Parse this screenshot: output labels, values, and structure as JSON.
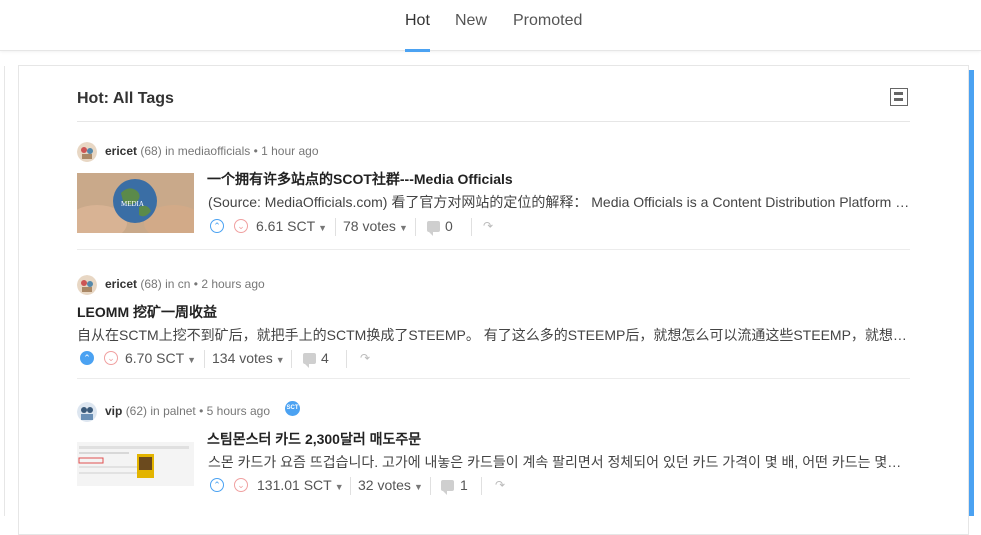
{
  "nav": {
    "tabs": [
      {
        "label": "Hot",
        "active": true
      },
      {
        "label": "New",
        "active": false
      },
      {
        "label": "Promoted",
        "active": false
      }
    ]
  },
  "feed": {
    "title": "Hot: All Tags",
    "view_toggle_icon": "list-view-icon"
  },
  "posts": [
    {
      "author": "ericet",
      "reputation": "(68)",
      "in_word": "in",
      "community": "mediaofficials",
      "time": "• 1 hour ago",
      "title": "一个拥有许多站点的SCOT社群---Media Officials",
      "excerpt": "(Source: MediaOfficials.com) 看了官方对网站的定位的解释： Media Officials is a Content Distribution Platform that enables users to earn",
      "payout": "6.61 SCT",
      "votes": "78 votes",
      "comments": "0",
      "upvoted": false
    },
    {
      "author": "ericet",
      "reputation": "(68)",
      "in_word": "in",
      "community": "cn",
      "time": "• 2 hours ago",
      "title": "LEOMM 挖矿一周收益",
      "excerpt": "自从在SCTM上挖不到矿后，就把手上的SCTM换成了STEEMP。 有了这么多的STEEMP后，就想怎么可以流通这些STEEMP，就想到了挖矿",
      "payout": "6.70 SCT",
      "votes": "134 votes",
      "comments": "4",
      "upvoted": true
    },
    {
      "author": "vip",
      "reputation": "(62)",
      "in_word": "in",
      "community": "palnet",
      "time": "• 5 hours ago",
      "badge": "SCT",
      "title": "스팀몬스터 카드 2,300달러 매도주문",
      "excerpt": "스몬 카드가 요즘 뜨겁습니다. 고가에 내놓은 카드들이 계속 팔리면서 정체되어 있던 카드 가격이 몇 배, 어떤 카드는 몇십 배",
      "payout": "131.01 SCT",
      "votes": "32 votes",
      "comments": "1",
      "upvoted": false
    }
  ],
  "colors": {
    "accent": "#4ba2f2",
    "downvote": "#f0a0a0"
  }
}
